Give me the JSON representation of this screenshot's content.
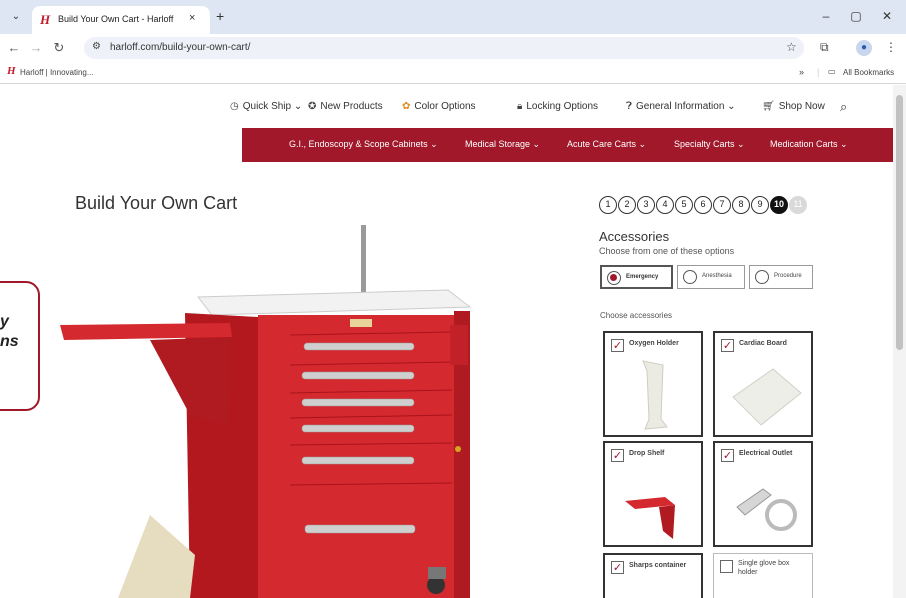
{
  "browser": {
    "tab_title": "Build Your Own Cart - Harloff",
    "tab_logo": "H",
    "tab_close": "×",
    "new_tab": "+",
    "url": "harloff.com/build-your-own-cart/",
    "bookmark_label": "Harloff | Innovating...",
    "bookmark_logo": "H",
    "all_bookmarks": "All Bookmarks",
    "overflow": "»",
    "icons": [
      "back-icon",
      "forward-icon",
      "reload-icon",
      "site-settings-icon",
      "star-icon",
      "extensions-icon",
      "profile-icon",
      "menu-icon",
      "minimize-icon",
      "maximize-icon",
      "close-icon"
    ]
  },
  "topnav": {
    "items": [
      {
        "label": "Quick Ship",
        "icon": "clock-icon"
      },
      {
        "label": "New Products",
        "icon": "badge-icon"
      },
      {
        "label": "Color Options",
        "icon": "palette-icon"
      },
      {
        "label": "Locking Options",
        "icon": "lock-icon"
      },
      {
        "label": "General Information",
        "icon": "question-icon"
      },
      {
        "label": "Shop Now",
        "icon": "cart-icon"
      }
    ]
  },
  "category_nav": {
    "items": [
      "G.I., Endoscopy & Scope Cabinets",
      "Medical Storage",
      "Acute Care Carts",
      "Specialty Carts",
      "Medication Carts"
    ]
  },
  "page_title": "Build Your Own Cart",
  "callout": {
    "line1": "y",
    "line2": "ns"
  },
  "steps": {
    "numbers": [
      "1",
      "2",
      "3",
      "4",
      "5",
      "6",
      "7",
      "8",
      "9",
      "10",
      "11"
    ],
    "active": "10"
  },
  "accessories": {
    "heading": "Accessories",
    "subheading": "Choose from one of these options",
    "options": [
      {
        "label": "Emergency",
        "selected": true
      },
      {
        "label": "Anesthesia",
        "selected": false
      },
      {
        "label": "Procedure",
        "selected": false
      }
    ],
    "choose_label": "Choose accessories",
    "cards": [
      {
        "label": "Oxygen Holder",
        "checked": true
      },
      {
        "label": "Cardiac Board",
        "checked": true
      },
      {
        "label": "Drop Shelf",
        "checked": true
      },
      {
        "label": "Electrical Outlet",
        "checked": true
      },
      {
        "label": "Sharps container",
        "checked": true
      },
      {
        "label": "Single glove box holder",
        "checked": false
      }
    ]
  },
  "colors": {
    "brand_red": "#a0182a",
    "cart_red": "#d42a2f",
    "chrome_tabbar": "#dfe6f3"
  }
}
